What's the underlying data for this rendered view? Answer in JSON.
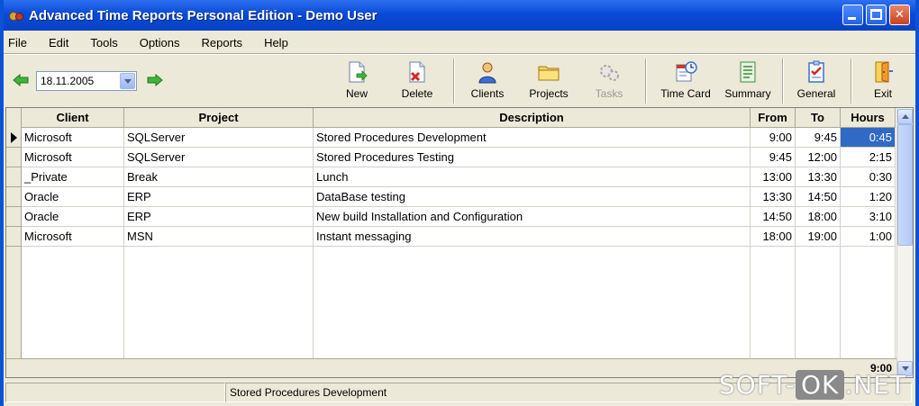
{
  "window": {
    "title": "Advanced Time Reports Personal Edition - Demo User"
  },
  "menu": [
    "File",
    "Edit",
    "Tools",
    "Options",
    "Reports",
    "Help"
  ],
  "date": {
    "value": "18.11.2005"
  },
  "toolbar": {
    "new": "New",
    "delete": "Delete",
    "clients": "Clients",
    "projects": "Projects",
    "tasks": "Tasks",
    "time_card": "Time Card",
    "summary": "Summary",
    "general": "General",
    "exit": "Exit"
  },
  "grid": {
    "columns": [
      "Client",
      "Project",
      "Description",
      "From",
      "To",
      "Hours"
    ],
    "rows": [
      {
        "client": "Microsoft",
        "project": "SQLServer",
        "description": "Stored Procedures Development",
        "from": "9:00",
        "to": "9:45",
        "hours": "0:45"
      },
      {
        "client": "Microsoft",
        "project": "SQLServer",
        "description": "Stored Procedures Testing",
        "from": "9:45",
        "to": "12:00",
        "hours": "2:15"
      },
      {
        "client": "_Private",
        "project": "Break",
        "description": "Lunch",
        "from": "13:00",
        "to": "13:30",
        "hours": "0:30"
      },
      {
        "client": "Oracle",
        "project": "ERP",
        "description": "DataBase testing",
        "from": "13:30",
        "to": "14:50",
        "hours": "1:20"
      },
      {
        "client": "Oracle",
        "project": "ERP",
        "description": "New build Installation and Configuration",
        "from": "14:50",
        "to": "18:00",
        "hours": "3:10"
      },
      {
        "client": "Microsoft",
        "project": "MSN",
        "description": "Instant messaging",
        "from": "18:00",
        "to": "19:00",
        "hours": "1:00"
      }
    ],
    "total": "9:00"
  },
  "status": {
    "panel1": "",
    "panel2": "Stored Procedures Development"
  },
  "watermark": {
    "left": "SOFT-",
    "ok": "OK",
    "right": ".NET"
  }
}
